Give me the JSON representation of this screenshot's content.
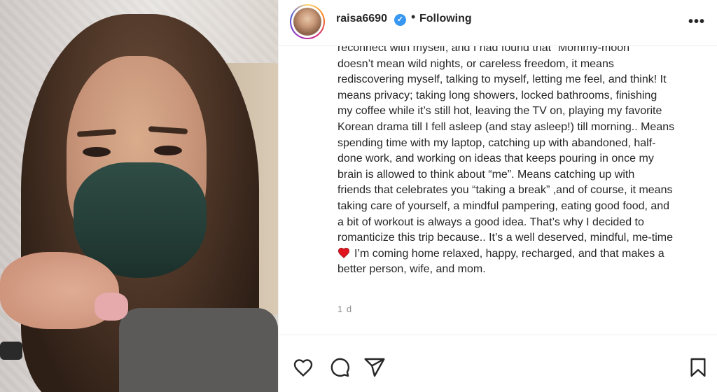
{
  "post": {
    "username": "raisa6690",
    "verified_mark": "✓",
    "separator": "•",
    "follow_status": "Following",
    "more_label": "•••",
    "caption_lines": [
      "reconnect with myself, and I had found that “Mommy-moon”",
      "doesn’t mean wild nights, or careless freedom, it means",
      "rediscovering myself, talking to myself, letting me feel, and think! It",
      "means privacy; taking long showers, locked bathrooms, finishing",
      "my coffee while it’s still hot, leaving the TV on, playing my favorite",
      "Korean drama till I fell asleep (and stay asleep!) till morning.. Means",
      "spending time with my laptop, catching up with abandoned, half-",
      "done work, and working on ideas that keeps pouring in once my",
      "brain is allowed to think about “me”. Means catching up with",
      "friends that celebrates you “taking a break” ,and of course, it means",
      "taking care of yourself, a mindful pampering, eating good food, and",
      "a bit of workout is always a good idea. That’s why I decided to",
      "romanticize this trip because.. It’s a well deserved, mindful, me-time",
      "I’m coming home relaxed, happy, recharged, and that makes a",
      "better person, wife, and mom."
    ],
    "timestamp": "1 d"
  },
  "icons": {
    "like": "heart-outline-icon",
    "comment": "comment-bubble-icon",
    "share": "paper-plane-icon",
    "save": "bookmark-icon",
    "emoji": "red-heart-emoji"
  },
  "colors": {
    "verified": "#3897f0",
    "emoji_heart": "#e0151f",
    "text": "#262626",
    "muted": "#8e8e8e"
  }
}
